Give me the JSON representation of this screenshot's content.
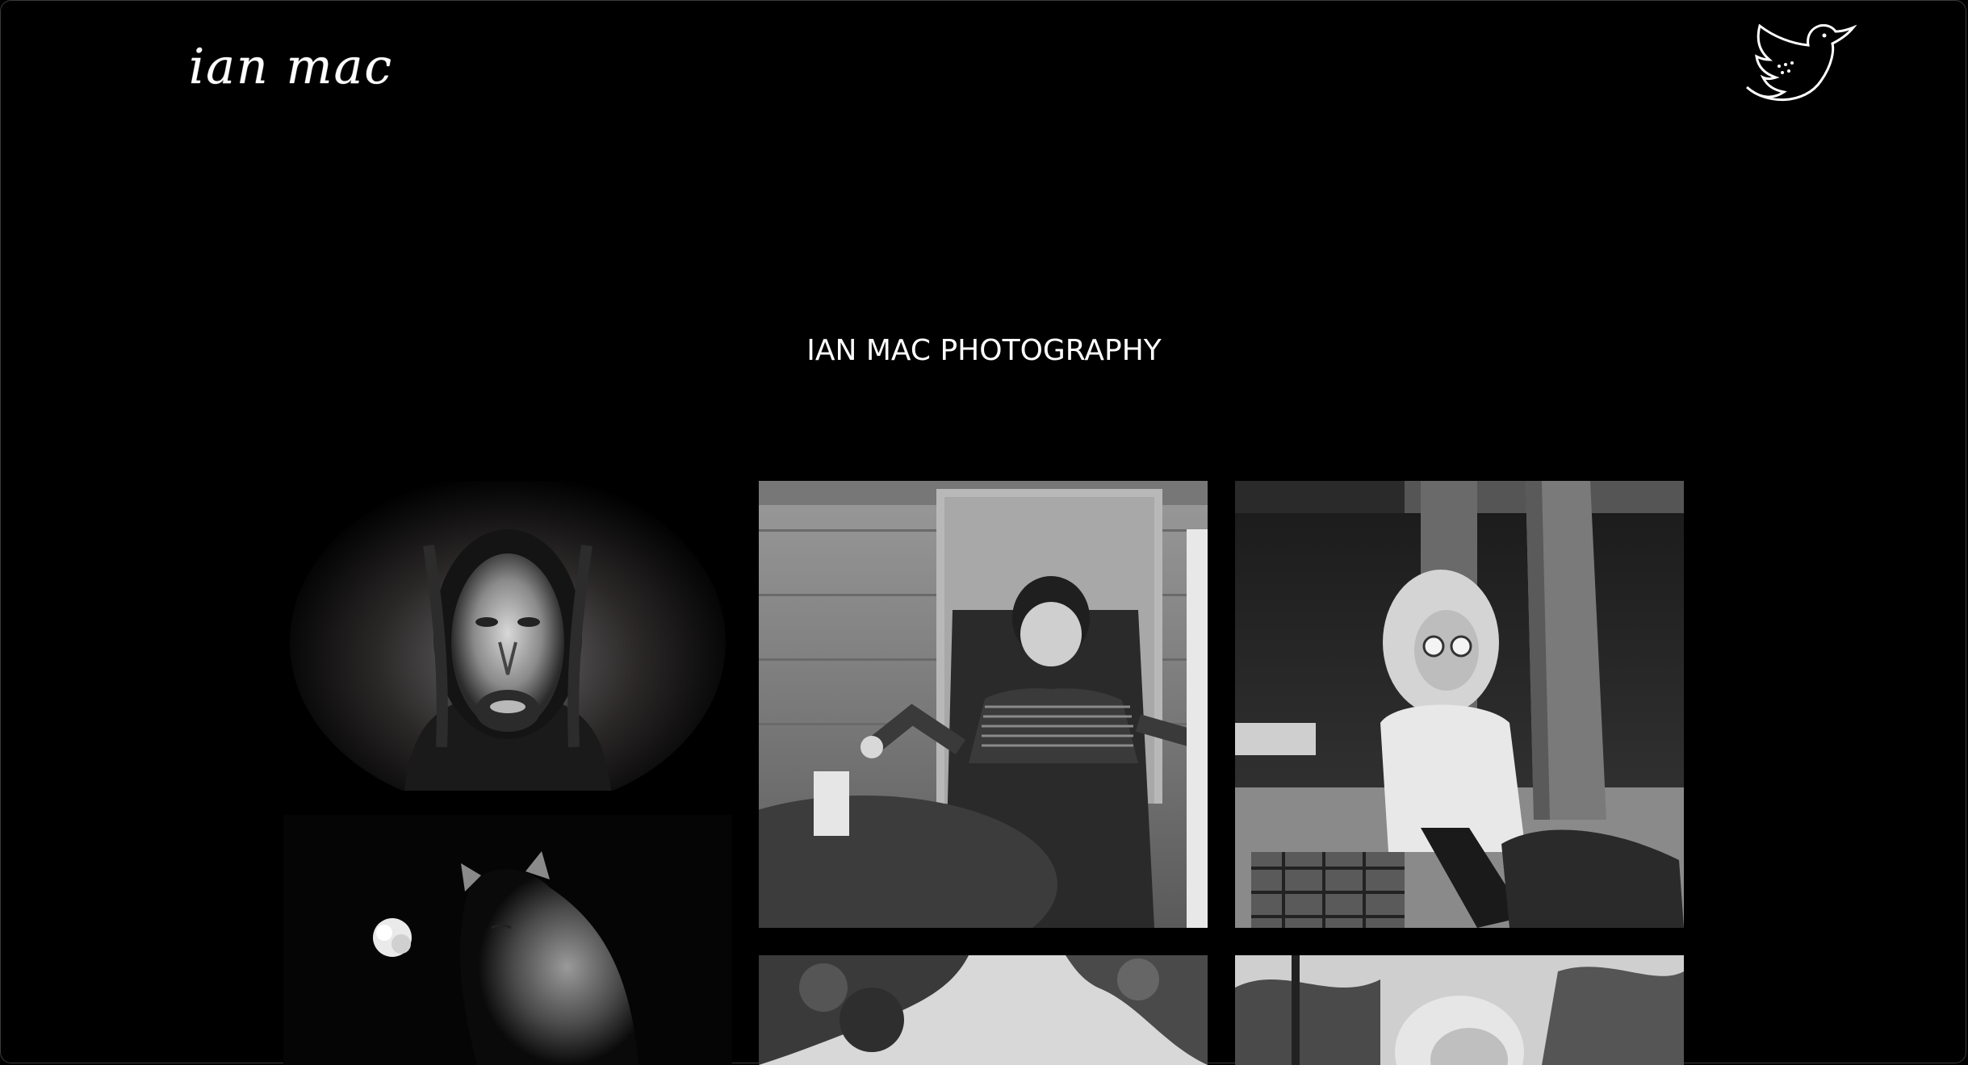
{
  "header": {
    "logo_text": "ian mac",
    "social_icon": "twitter-bird-icon"
  },
  "main": {
    "title": "IAN MAC PHOTOGRAPHY"
  },
  "gallery": [
    {
      "subject": "portrait-man-dreadlocks"
    },
    {
      "subject": "cat-with-flower"
    },
    {
      "subject": "boy-in-lawn-chair"
    },
    {
      "subject": "woman-with-sunglasses-sitting"
    },
    {
      "subject": "trees-canopy"
    },
    {
      "subject": "blonde-person-outdoors"
    }
  ],
  "colors": {
    "background": "#000000",
    "text": "#ffffff"
  }
}
